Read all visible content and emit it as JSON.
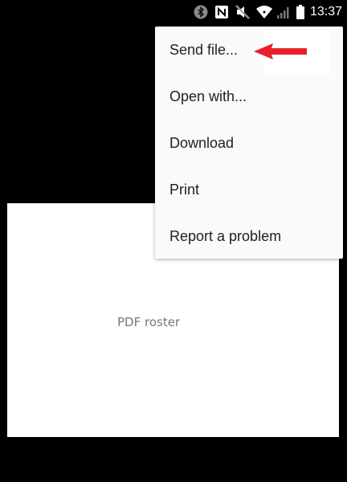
{
  "status_bar": {
    "time": "13:37",
    "icons": [
      "bluetooth-icon",
      "nfc-icon",
      "muted-icon",
      "wifi-icon",
      "signal-icon",
      "battery-icon"
    ]
  },
  "menu": {
    "items": [
      {
        "label": "Send file..."
      },
      {
        "label": "Open with..."
      },
      {
        "label": "Download"
      },
      {
        "label": "Print"
      },
      {
        "label": "Report a problem"
      }
    ]
  },
  "preview": {
    "label": "PDF roster"
  },
  "colors": {
    "background": "#000000",
    "menu_bg": "#fafafa",
    "menu_text": "#212121",
    "preview_bg": "#ffffff",
    "preview_text": "#777777",
    "annotation_arrow": "#e8202a"
  }
}
